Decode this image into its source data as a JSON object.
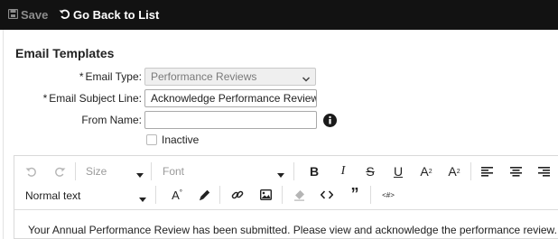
{
  "toolbar": {
    "save_label": "Save",
    "back_label": "Go Back to List"
  },
  "form": {
    "title": "Email Templates",
    "email_type": {
      "label": "Email Type:",
      "required_mark": "*",
      "value": "Performance Reviews"
    },
    "subject": {
      "label": "Email Subject Line:",
      "required_mark": "*",
      "value": "Acknowledge Performance Review"
    },
    "from_name": {
      "label": "From Name:",
      "value": ""
    },
    "inactive": {
      "label": "Inactive",
      "checked": false
    }
  },
  "editor": {
    "size_label": "Size",
    "font_label": "Font",
    "format_label": "Normal text",
    "body": "Your Annual Performance Review has been submitted. Please view and acknowledge the performance review."
  },
  "icons": {
    "save": "save-icon",
    "back": "undo-arrow-icon",
    "info": "info-icon",
    "undo": "undo-icon",
    "redo": "redo-icon",
    "bold": "bold-icon",
    "italic": "italic-icon",
    "strike": "strikethrough-icon",
    "underline": "underline-icon",
    "superscript": "superscript-icon",
    "subscript": "subscript-icon",
    "align_left": "align-left-icon",
    "align_center": "align-center-icon",
    "align_right": "align-right-icon",
    "font_color": "font-color-icon",
    "highlight": "highlighter-icon",
    "link": "link-icon",
    "image": "image-icon",
    "clear_format": "eraser-icon",
    "code": "code-icon",
    "quote": "quote-icon",
    "placeholder": "placeholder-tag-icon"
  },
  "colors": {
    "topbar_bg": "#121212",
    "disabled_gray": "#8c8c8c"
  }
}
